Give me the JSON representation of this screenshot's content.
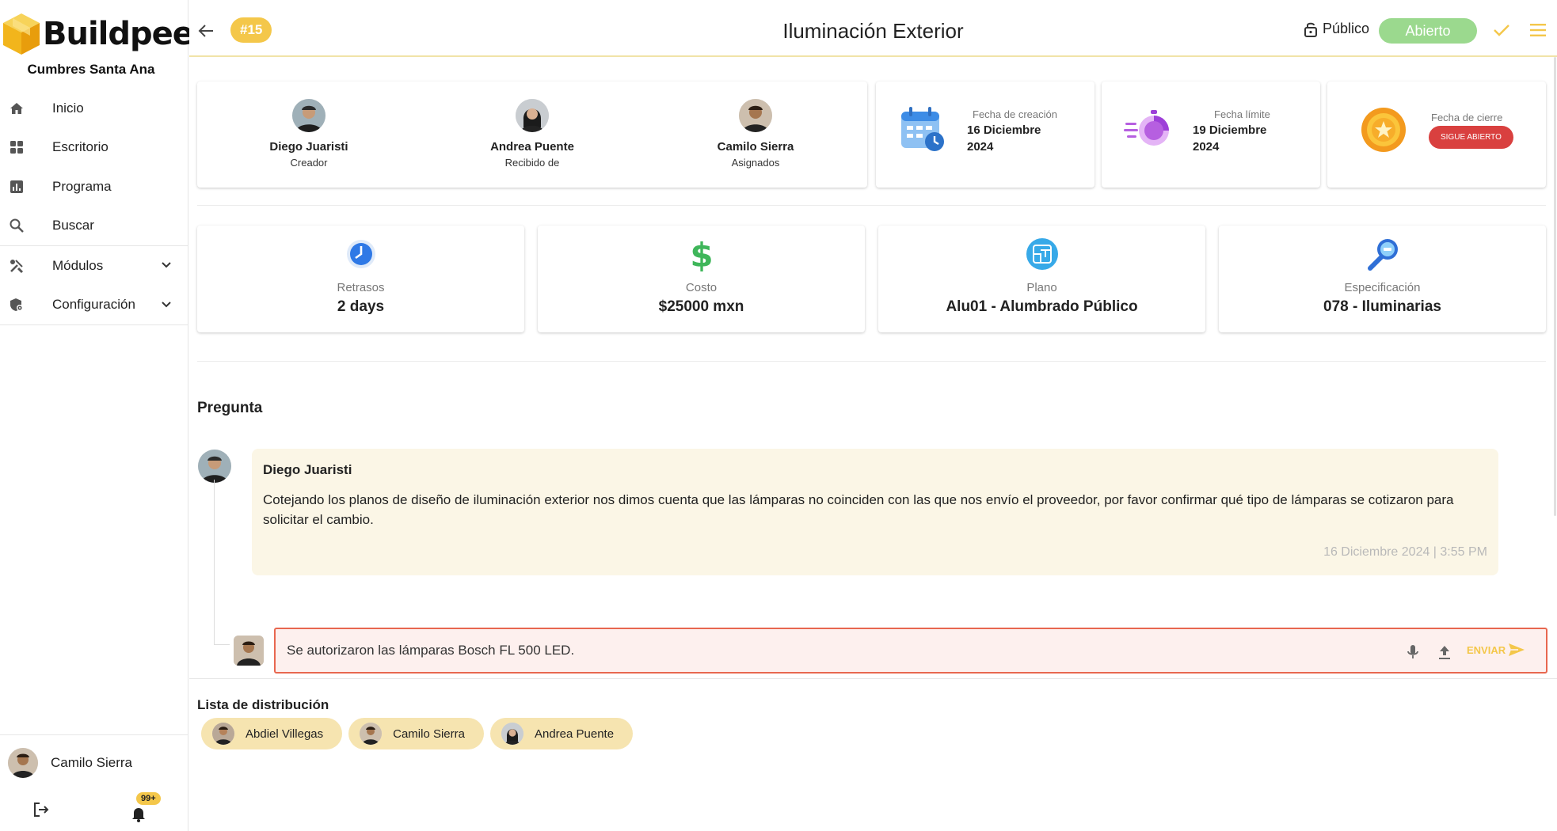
{
  "sidebar": {
    "brand": "Buildpeer",
    "project": "Cumbres Santa Ana",
    "items": [
      {
        "label": "Inicio",
        "icon": "home-icon"
      },
      {
        "label": "Escritorio",
        "icon": "dashboard-icon"
      },
      {
        "label": "Programa",
        "icon": "chart-icon"
      },
      {
        "label": "Buscar",
        "icon": "search-icon"
      },
      {
        "label": "Módulos",
        "icon": "tools-icon"
      },
      {
        "label": "Configuración",
        "icon": "settings-shield-icon"
      }
    ],
    "user": "Camilo Sierra",
    "notifications_badge": "99+"
  },
  "header": {
    "ticket": "#15",
    "title": "Iluminación Exterior",
    "visibility": "Público",
    "status": "Abierto"
  },
  "people": [
    {
      "name": "Diego Juaristi",
      "role": "Creador"
    },
    {
      "name": "Andrea Puente",
      "role": "Recibido de"
    },
    {
      "name": "Camilo Sierra",
      "role": "Asignados"
    }
  ],
  "dates": {
    "created": {
      "label": "Fecha de creación",
      "line1": "16 Diciembre",
      "line2": "2024"
    },
    "due": {
      "label": "Fecha límite",
      "line1": "19 Diciembre",
      "line2": "2024"
    },
    "closed": {
      "label": "Fecha de cierre",
      "status": "SIGUE ABIERTO"
    }
  },
  "stats": [
    {
      "label": "Retrasos",
      "value": "2 days"
    },
    {
      "label": "Costo",
      "value": "$25000 mxn"
    },
    {
      "label": "Plano",
      "value": "Alu01 - Alumbrado Público"
    },
    {
      "label": "Especificación",
      "value": "078 - Iluminarias"
    }
  ],
  "question": {
    "section_title": "Pregunta",
    "author": "Diego Juaristi",
    "message": "Cotejando los planos de diseño de iluminación exterior nos dimos cuenta que las lámparas no coinciden con las que nos envío el proveedor, por favor confirmar qué tipo de lámparas se cotizaron para solicitar el cambio.",
    "timestamp": "16 Diciembre 2024 | 3:55 PM"
  },
  "reply": {
    "value": "Se autorizaron las lámparas Bosch FL 500 LED.",
    "send_label": "ENVIAR"
  },
  "distribution": {
    "title": "Lista de distribución",
    "members": [
      "Abdiel Villegas",
      "Camilo Sierra",
      "Andrea Puente"
    ]
  },
  "colors": {
    "accent": "#f4c74a",
    "status_open": "#9bd98e",
    "closed_pill": "#d9403f",
    "reply_border": "#e8674f",
    "bubble_bg": "#fbf6e6"
  }
}
